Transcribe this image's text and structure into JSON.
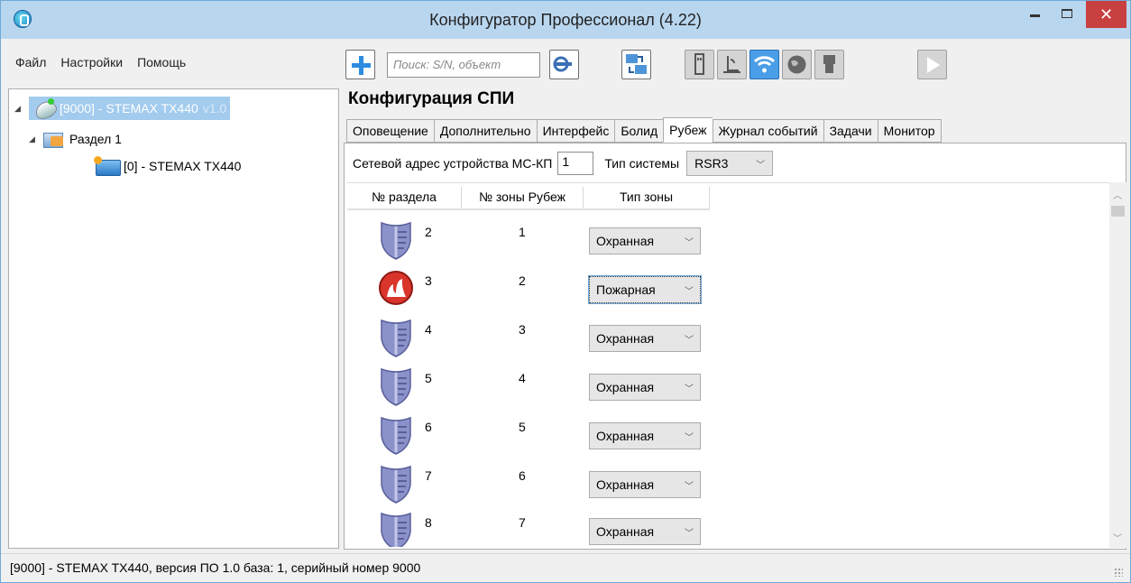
{
  "window": {
    "title": "Конфигуратор Профессионал (4.22)"
  },
  "menu": {
    "items": [
      "Файл",
      "Настройки",
      "Помощь"
    ]
  },
  "toolbar": {
    "search_placeholder": "Поиск: S/N, объект"
  },
  "tree": {
    "root_label": "[9000] - STEMAX TX440",
    "root_version": "v1.0",
    "section_label": "Раздел 1",
    "device_label": "[0] - STEMAX TX440"
  },
  "config": {
    "title": "Конфигурация СПИ",
    "tabs": [
      "Оповещение",
      "Дополнительно",
      "Интерфейс",
      "Болид",
      "Рубеж",
      "Журнал событий",
      "Задачи",
      "Монитор"
    ],
    "active_tab": "Рубеж",
    "address_label": "Сетевой адрес устройства МС-КП",
    "address_value": "1",
    "system_type_label": "Тип системы",
    "system_type_value": "RSR3"
  },
  "grid": {
    "headers": [
      "№ раздела",
      "№ зоны Рубеж",
      "Тип зоны"
    ],
    "rows": [
      {
        "partition": "2",
        "zone": "1",
        "type": "Охранная",
        "icon": "shield-icon"
      },
      {
        "partition": "3",
        "zone": "2",
        "type": "Пожарная",
        "icon": "fire-icon"
      },
      {
        "partition": "4",
        "zone": "3",
        "type": "Охранная",
        "icon": "shield-icon"
      },
      {
        "partition": "5",
        "zone": "4",
        "type": "Охранная",
        "icon": "shield-icon"
      },
      {
        "partition": "6",
        "zone": "5",
        "type": "Охранная",
        "icon": "shield-icon"
      },
      {
        "partition": "7",
        "zone": "6",
        "type": "Охранная",
        "icon": "shield-icon"
      },
      {
        "partition": "8",
        "zone": "7",
        "type": "Охранная",
        "icon": "shield-icon"
      }
    ]
  },
  "status": {
    "text": "[9000] - STEMAX TX440, версия ПО 1.0 база: 1, серийный номер 9000"
  },
  "colors": {
    "selection": "#a2cbee",
    "titlebar": "#b9d6ef",
    "close": "#c94040",
    "accent": "#2d8be0"
  }
}
